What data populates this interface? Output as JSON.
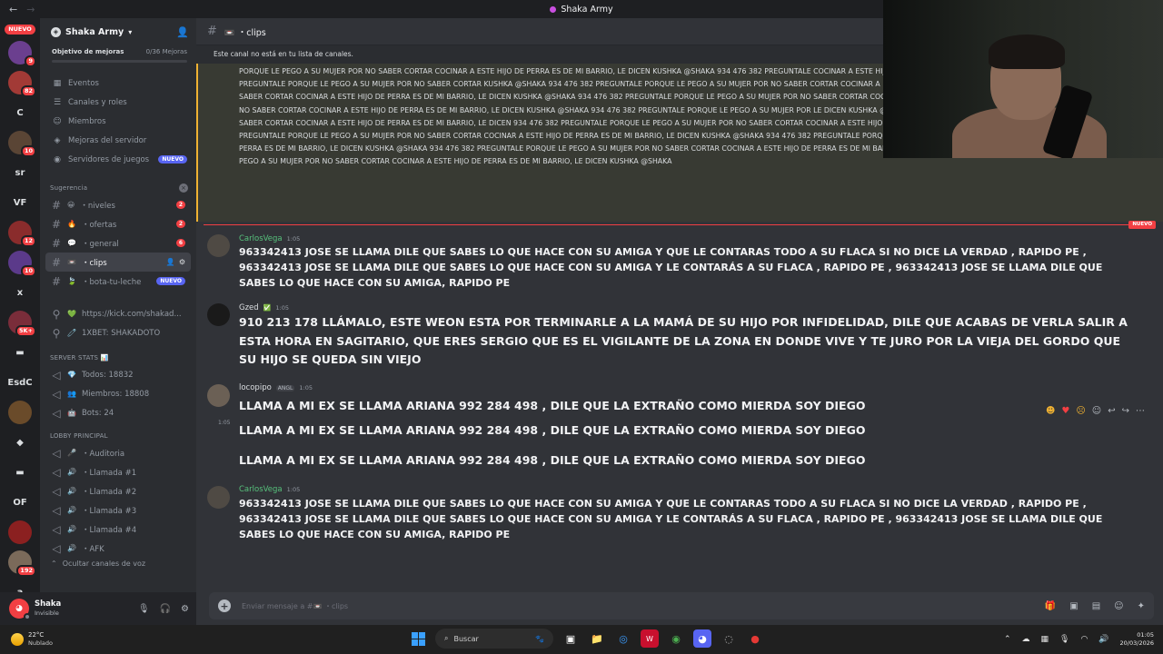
{
  "window": {
    "title": "Shaka Army"
  },
  "rail": {
    "nuevo": "NUEVO",
    "items": [
      {
        "label": "",
        "color": "#6b3f8f",
        "badge": "9"
      },
      {
        "label": "",
        "color": "#a23a36",
        "badge": "82"
      },
      {
        "label": "C",
        "color": "#313338",
        "badge": ""
      },
      {
        "label": "",
        "color": "#5a4535",
        "badge": "10"
      },
      {
        "label": "sr",
        "color": "#313338",
        "badge": ""
      },
      {
        "label": "VF",
        "color": "#313338",
        "badge": ""
      },
      {
        "label": "",
        "color": "#8a2c2c",
        "badge": "12"
      },
      {
        "label": "",
        "color": "#5b3a8a",
        "badge": "10"
      },
      {
        "label": "x",
        "color": "#313338",
        "badge": ""
      },
      {
        "label": "",
        "color": "#7a2d3a",
        "badge": "5K+"
      },
      {
        "label": "▬",
        "color": "#313338",
        "badge": ""
      },
      {
        "label": "EsdC",
        "color": "#313338",
        "badge": ""
      },
      {
        "label": "",
        "color": "#6a4b2a",
        "badge": ""
      },
      {
        "label": "◆",
        "color": "#313338",
        "badge": ""
      },
      {
        "label": "▬",
        "color": "#313338",
        "badge": ""
      },
      {
        "label": "OF",
        "color": "#313338",
        "badge": ""
      },
      {
        "label": "",
        "color": "#8b2020",
        "badge": ""
      },
      {
        "label": "",
        "color": "#7b6a5a",
        "badge": "192"
      },
      {
        "label": "a",
        "color": "#313338",
        "badge": ""
      },
      {
        "label": "B",
        "color": "#313338",
        "badge": ""
      }
    ]
  },
  "sidebar": {
    "server_name": "Shaka Army",
    "goal_label": "Objetivo de mejoras",
    "goal_count": "0/36 Mejoras",
    "nav": [
      {
        "icon": "▦",
        "label": "Eventos"
      },
      {
        "icon": "☰",
        "label": "Canales y roles"
      },
      {
        "icon": "☺",
        "label": "Miembros"
      },
      {
        "icon": "◈",
        "label": "Mejoras del servidor"
      },
      {
        "icon": "◉",
        "label": "Servidores de juegos",
        "pill": "NUEVO"
      }
    ],
    "suggest_label": "Sugerencia",
    "channels": [
      {
        "emoji": "😀",
        "label": "・niveles",
        "count": "2"
      },
      {
        "emoji": "🔥",
        "label": "・ofertas",
        "count": "2"
      },
      {
        "emoji": "💬",
        "label": "・general",
        "count": "6"
      },
      {
        "emoji": "📼",
        "label": "・clips",
        "count": ""
      },
      {
        "emoji": "🍃",
        "label": "・bota-tu-leche",
        "count": "",
        "pill": "NUEVO"
      }
    ],
    "links": [
      {
        "emoji": "💚",
        "label": "https://kick.com/shakad..."
      },
      {
        "emoji": "🧷",
        "label": "1XBET: SHAKADOTO"
      }
    ],
    "stats_label": "SERVER STATS 📊",
    "stats": [
      {
        "emoji": "💎",
        "label": "Todos: 18832"
      },
      {
        "emoji": "👥",
        "label": "Miembros: 18808"
      },
      {
        "emoji": "🤖",
        "label": "Bots: 24"
      }
    ],
    "lobby_label": "LOBBY PRINCIPAL",
    "voice": [
      {
        "emoji": "🎤",
        "label": "・Auditoria"
      },
      {
        "emoji": "🔊",
        "label": "・Llamada #1"
      },
      {
        "emoji": "🔊",
        "label": "・Llamada #2"
      },
      {
        "emoji": "🔊",
        "label": "・Llamada #3"
      },
      {
        "emoji": "🔊",
        "label": "・Llamada #4"
      },
      {
        "emoji": "🔊",
        "label": "・AFK"
      }
    ],
    "hide_voice": "Ocultar canales de voz"
  },
  "user": {
    "name": "Shaka",
    "status": "Invisible"
  },
  "channel": {
    "name": "📼 ・clips",
    "notice": "Este canal no está en tu lista de canales."
  },
  "spam_text": "PORQUE LE PEGO A SU MUJER POR NO SABER CORTAR COCINAR A ESTE HIJO DE PERRA ES DE MI BARRIO, LE DICEN KUSHKA @Shaka 934 476 382 PREGUNTALE COCINAR A ESTE HIJO DE PERRA ES DE MI BARRIO, LE DICEN KUSHKA @Shaka 934 476 382 PREGUNTALE PORQUE LE PEGO A SU MUJER POR NO SABER CORTAR KUSHKA @Shaka 934 476 382 PREGUNTALE PORQUE LE PEGO A SU MUJER POR NO SABER CORTAR COCINAR A ESTE HIJO DE PERRA ES DE MI BARRIO, LE DICEN A SU MUJER POR NO SABER CORTAR COCINAR A ESTE HIJO DE PERRA ES DE MI BARRIO, LE DICEN KUSHKA @Shaka 934 476 382 PREGUNTALE PORQUE LE PEGO A SU MUJER POR NO SABER CORTAR COCINAR A ESTE HIJO DE PERRA ES DE MI BARRIO, LE DICEN KUSHKA @Shaka NO SABER CORTAR COCINAR A ESTE HIJO DE PERRA ES DE MI BARRIO, LE DICEN KUSHKA @Shaka 934 476 382 PREGUNTALE PORQUE LE PEGO A SU MUJER POR LE DICEN KUSHKA @Shaka 934 476 382 PREGUNTALE PORQUE LE PEGO A SU MUJER POR NO SABER CORTAR COCINAR A ESTE HIJO DE PERRA ES DE MI BARRIO, LE DICEN 934 476 382 PREGUNTALE PORQUE LE PEGO A SU MUJER POR NO SABER CORTAR COCINAR A ESTE HIJO DE PERRA ES DE MI BARRIO, LE DICEN KUSHKA @Shaka 934 476 382 PREGUNTALE PORQUE LE PEGO A SU MUJER POR NO SABER CORTAR COCINAR A ESTE HIJO DE PERRA ES DE MI BARRIO, LE DICEN KUSHKA @Shaka 934 476 382 PREGUNTALE PORQUE LE PEGO A SU MUJER POR NO SABER CORTAR COCINAR A ESTE HIJO DE PERRA ES DE MI BARRIO, LE DICEN KUSHKA @Shaka 934 476 382 PREGUNTALE PORQUE LE PEGO A SU MUJER POR NO SABER CORTAR COCINAR A ESTE HIJO DE PERRA ES DE MI BARRIO, LE DICEN KUSHKA @Shaka 934 476 382 PREGUNTALE PORQUE LE PEGO A SU MUJER POR NO SABER CORTAR COCINAR A ESTE HIJO DE PERRA ES DE MI BARRIO, LE DICEN KUSHKA @Shaka",
  "new_label": "NUEVO",
  "messages": [
    {
      "author": "CarlosVega",
      "color": "#57c27c",
      "time": "1:05",
      "text": "963342413 JOSE SE LLAMA DILE QUE SABES LO QUE HACE CON SU AMIGA Y QUE LE CONTARAS TODO A SU FLACA SI NO DICE LA VERDAD , RAPIDO PE , 963342413 JOSE SE LLAMA DILE QUE SABES LO QUE HACE CON SU AMIGA Y LE CONTARÁS A SU FLACA , RAPIDO PE   , 963342413 JOSE SE LLAMA DILE QUE SABES LO QUE HACE CON SU AMIGA, RAPIDO PE"
    },
    {
      "author": "Gzed",
      "color": "#f2f3f5",
      "time": "1:05",
      "badge": "✅",
      "text": "910 213 178 LLÁMALO, ESTE WEON ESTA POR TERMINARLE A LA MAMÁ DE SU HIJO POR INFIDELIDAD, DILE QUE ACABAS DE VERLA SALIR A ESTA HORA EN SAGITARIO, QUE ERES SERGIO QUE ES EL VIGILANTE DE LA ZONA EN DONDE VIVE Y TE JURO POR LA VIEJA DEL GORDO QUE SU HIJO SE QUEDA SIN VIEJO"
    },
    {
      "author": "locopipo",
      "color": "#f2f3f5",
      "time": "1:05",
      "tag": "ANGL",
      "text": "LLAMA A MI EX  SE LLAMA ARIANA 992 284 498  , DILE QUE LA EXTRAÑO COMO MIERDA SOY DIEGO"
    },
    {
      "author": "CarlosVega",
      "color": "#57c27c",
      "time": "1:05",
      "text": "963342413 JOSE SE LLAMA DILE QUE SABES LO QUE HACE CON SU AMIGA Y QUE LE CONTARAS TODO A SU FLACA SI NO DICE LA VERDAD , RAPIDO PE , 963342413 JOSE SE LLAMA DILE QUE SABES LO QUE HACE CON SU AMIGA Y LE CONTARÁS A SU FLACA , RAPIDO PE   , 963342413 JOSE SE LLAMA DILE QUE SABES LO QUE HACE CON SU AMIGA, RAPIDO PE"
    }
  ],
  "continuations": [
    {
      "time": "1:05",
      "text": "LLAMA A MI EX  SE LLAMA ARIANA 992 284 498  , DILE QUE LA EXTRAÑO COMO MIERDA SOY DIEGO"
    },
    {
      "time": "",
      "text": "LLAMA A MI EX  SE LLAMA ARIANA 992 284 498  , DILE QUE LA EXTRAÑO COMO MIERDA SOY DIEGO"
    }
  ],
  "composer": {
    "placeholder": "Enviar mensaje a #📼 ・clips"
  },
  "taskbar": {
    "temp": "22°C",
    "weather": "Nublado",
    "search": "Buscar",
    "time": "01:05",
    "date": "20/03/2026"
  }
}
